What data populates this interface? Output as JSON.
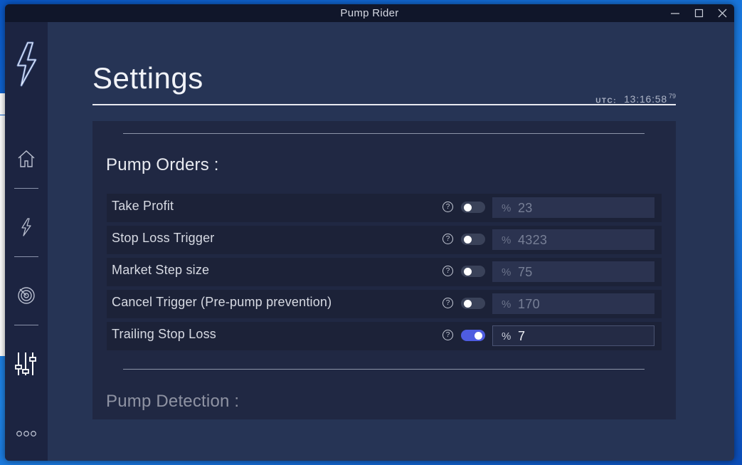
{
  "window": {
    "title": "Pump Rider"
  },
  "page": {
    "title": "Settings"
  },
  "clock": {
    "label": "UTC:",
    "time": "13:16:58",
    "ms": "79"
  },
  "sidebar": {
    "items": [
      {
        "name": "home",
        "icon": "home-icon"
      },
      {
        "name": "pump",
        "icon": "lightning-icon"
      },
      {
        "name": "radar",
        "icon": "radar-icon"
      },
      {
        "name": "settings",
        "icon": "sliders-icon"
      }
    ],
    "more_icon": "more-dots-icon"
  },
  "sections": {
    "pump_orders": {
      "title": "Pump Orders :",
      "rows": [
        {
          "label": "Take Profit",
          "enabled": false,
          "unit": "%",
          "value": "23"
        },
        {
          "label": "Stop Loss Trigger",
          "enabled": false,
          "unit": "%",
          "value": "4323"
        },
        {
          "label": "Market Step size",
          "enabled": false,
          "unit": "%",
          "value": "75"
        },
        {
          "label": "Cancel Trigger (Pre-pump prevention)",
          "enabled": false,
          "unit": "%",
          "value": "170"
        },
        {
          "label": "Trailing Stop Loss",
          "enabled": true,
          "unit": "%",
          "value": "7"
        }
      ]
    },
    "pump_detection": {
      "title": "Pump Detection :"
    }
  },
  "help_glyph": "?",
  "colors": {
    "accent": "#4e5ce0",
    "window_bg": "#263455",
    "sidebar_bg": "#1c2441",
    "panel_bg": "#202843",
    "logo_neon": "#8fb4ff"
  }
}
